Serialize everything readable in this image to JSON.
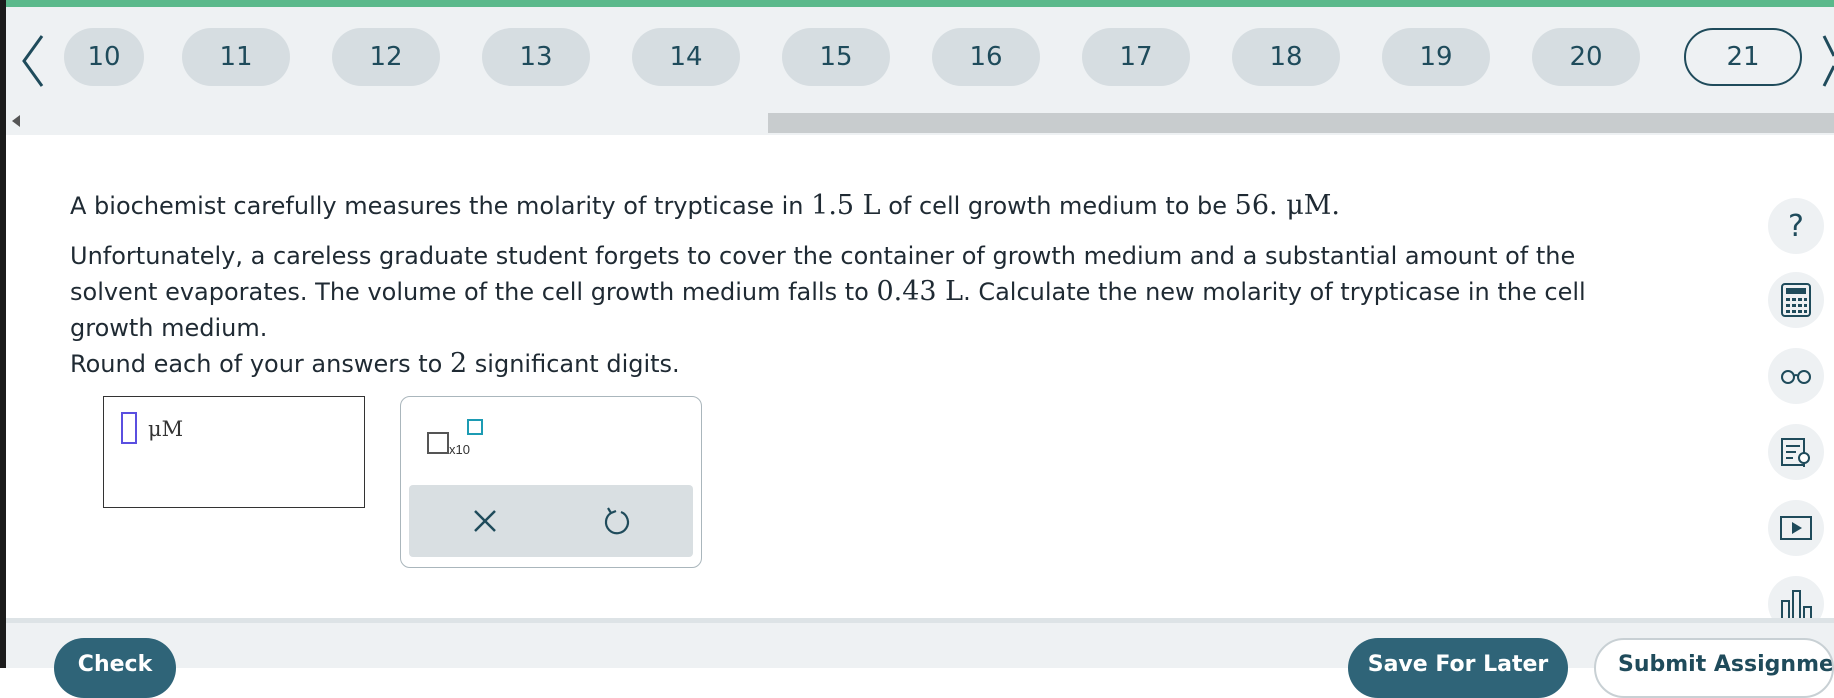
{
  "nav": {
    "pages": [
      "10",
      "11",
      "12",
      "13",
      "14",
      "15",
      "16",
      "17",
      "18",
      "19",
      "20",
      "21"
    ],
    "current_page": "21",
    "prev_icon": "chevron-left-icon",
    "next_icon": "chevron-right-icon"
  },
  "question": {
    "p1_a": "A biochemist carefully measures the molarity of trypticase in ",
    "p1_vol": "1.5 L",
    "p1_b": " of cell growth medium to be ",
    "p1_conc": "56. μM",
    "p1_c": ".",
    "p2_a": "Unfortunately, a careless graduate student forgets to cover the container of growth medium and a substantial amount of the solvent evaporates. The volume of the cell growth medium falls to ",
    "p2_vol": "0.43 L",
    "p2_b": ". Calculate the new molarity of trypticase in the cell growth medium.",
    "p3_a": "Round each of your answers to ",
    "p3_digits": "2",
    "p3_b": " significant digits."
  },
  "answer": {
    "unit": "μM",
    "value": ""
  },
  "tools": {
    "x10_label": "x10",
    "clear_icon": "close-icon",
    "undo_icon": "undo-icon"
  },
  "sidebar": {
    "help_glyph": "?",
    "icons": [
      "help-icon",
      "calculator-icon",
      "glasses-icon",
      "notes-icon",
      "video-icon",
      "chart-icon"
    ]
  },
  "footer": {
    "check_label": "Check",
    "save_label": "Save For Later",
    "submit_label": "Submit Assignment"
  },
  "colors": {
    "accent": "#2f6478",
    "top_line": "#5bb98b",
    "pill": "#d6dde1"
  }
}
